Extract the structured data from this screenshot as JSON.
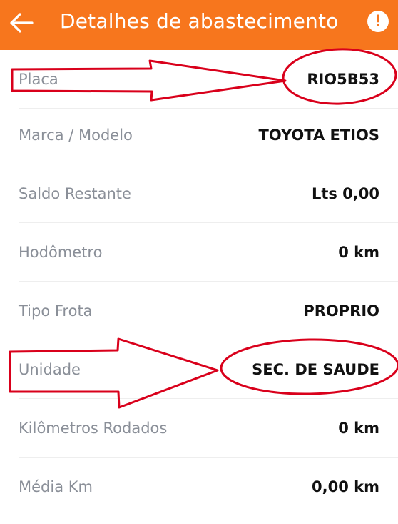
{
  "header": {
    "title": "Detalhes de abastecimento",
    "back_icon": "arrow-left-icon",
    "alert_icon": "exclamation-circle-icon",
    "alert_glyph": "!",
    "background_color": "#f7761d"
  },
  "details": [
    {
      "label": "Placa",
      "value": "RIO5B53"
    },
    {
      "label": "Marca / Modelo",
      "value": "TOYOTA ETIOS"
    },
    {
      "label": "Saldo Restante",
      "value": "Lts 0,00"
    },
    {
      "label": "Hodômetro",
      "value": "0 km"
    },
    {
      "label": "Tipo Frota",
      "value": "PROPRIO"
    },
    {
      "label": "Unidade",
      "value": "SEC. DE SAUDE"
    },
    {
      "label": "Kilômetros Rodados",
      "value": "0 km"
    },
    {
      "label": "Média Km",
      "value": "0,00 km"
    }
  ],
  "annotations": {
    "color": "#d9001b"
  }
}
